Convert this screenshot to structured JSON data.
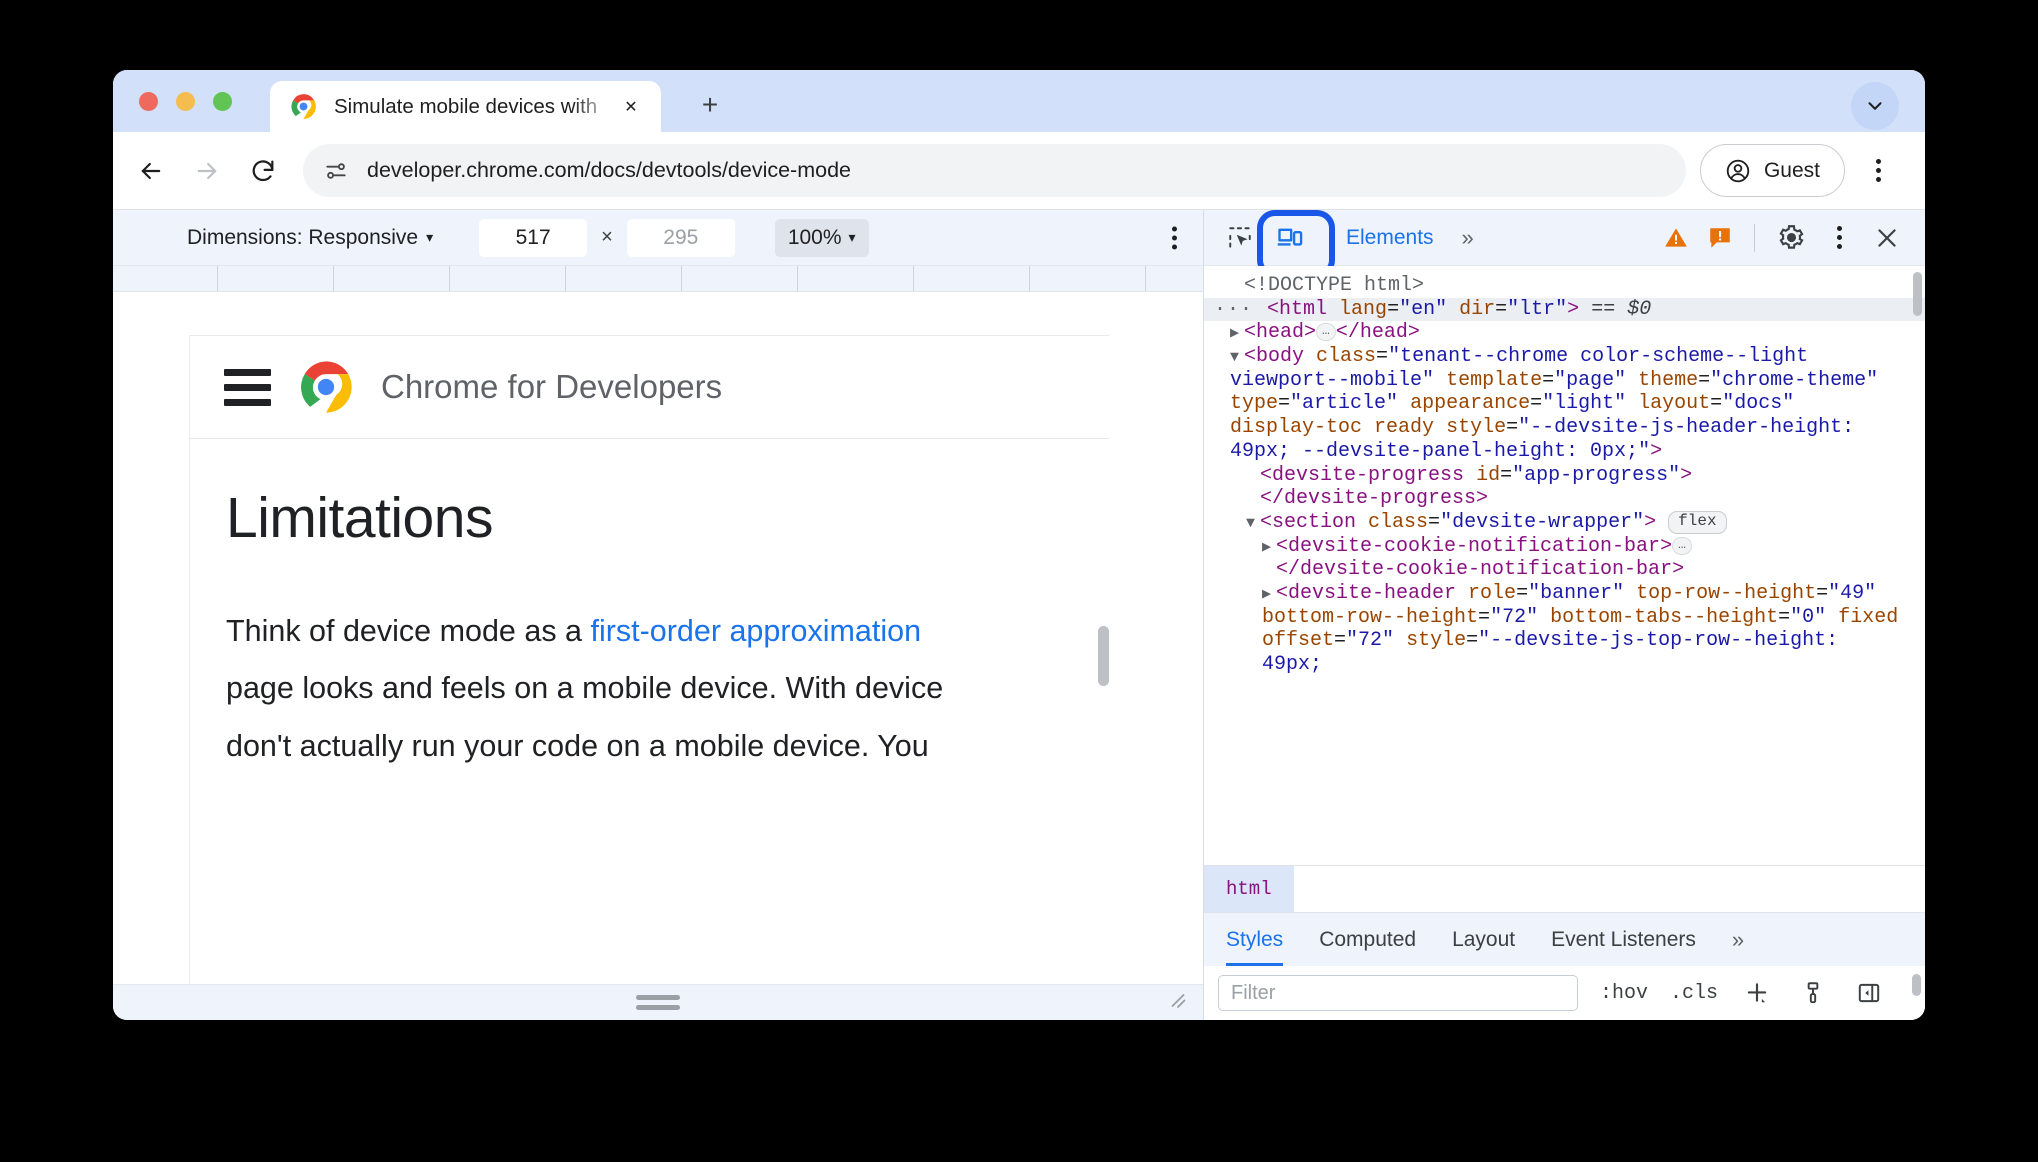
{
  "window": {
    "traffic_lights": [
      "close",
      "minimize",
      "maximize"
    ]
  },
  "tabstrip": {
    "tab_title": "Simulate mobile devices with",
    "close_label": "✕",
    "new_tab_label": "+",
    "collapse_label": "⌄"
  },
  "toolbar": {
    "back_label": "←",
    "forward_label": "→",
    "reload_label": "⟳",
    "url": "developer.chrome.com/docs/devtools/device-mode",
    "guest_label": "Guest"
  },
  "device_toolbar": {
    "dimensions_label": "Dimensions: Responsive",
    "dimensions_caret": "▾",
    "width_value": "517",
    "times": "×",
    "height_value": "295",
    "zoom_value": "100%",
    "zoom_caret": "▾"
  },
  "page": {
    "site_title": "Chrome for Developers",
    "heading": "Limitations",
    "paragraph_part1": "Think of device mode as a ",
    "paragraph_link": "first-order approximation",
    "paragraph_line2": "page looks and feels on a mobile device. With device",
    "paragraph_line3": "don't actually run your code on a mobile device. You"
  },
  "devtools": {
    "tabs": [
      {
        "label": "Elements",
        "active": true
      }
    ],
    "overflow_label": "»",
    "dom": [
      {
        "indent": 1,
        "prefix": "",
        "tri": "",
        "html": "<span class=\"txt\">&lt;!DOCTYPE html&gt;</span>",
        "selected": false
      },
      {
        "indent": 0,
        "prefix": "···",
        "tri": "",
        "html": "<span class=\"tag\">&lt;html</span> <span class=\"attr\">lang</span>=<span class=\"val\">\"en\"</span> <span class=\"attr\">dir</span>=<span class=\"val\">\"ltr\"</span><span class=\"tag\">&gt;</span> <span class=\"dollar\">== $0</span>",
        "selected": true
      },
      {
        "indent": 1,
        "prefix": "",
        "tri": "▶",
        "html": "<span class=\"tag\">&lt;head&gt;</span><span class=\"ellipsis-badge\">…</span><span class=\"tag\">&lt;/head&gt;</span>",
        "selected": false
      },
      {
        "indent": 1,
        "prefix": "",
        "tri": "▼",
        "html": "<span class=\"tag\">&lt;body</span> <span class=\"attr\">class</span>=<span class=\"val\">\"tenant--chrome color-scheme--light viewport--mobile\"</span> <span class=\"attr\">template</span>=<span class=\"val\">\"page\"</span> <span class=\"attr\">theme</span>=<span class=\"val\">\"chrome-theme\"</span> <span class=\"attr\">type</span>=<span class=\"val\">\"article\"</span> <span class=\"attr\">appearance</span>=<span class=\"val\">\"light\"</span> <span class=\"attr\">layout</span>=<span class=\"val\">\"docs\"</span> <span class=\"attr\">display-toc</span> <span class=\"attr\">ready</span> <span class=\"attr\">style</span>=<span class=\"val\">\"--devsite-js-header-height: 49px; --devsite-panel-height: 0px;\"</span><span class=\"tag\">&gt;</span>",
        "selected": false
      },
      {
        "indent": 2,
        "prefix": "",
        "tri": "",
        "html": "<span class=\"tag\">&lt;devsite-progress</span> <span class=\"attr\">id</span>=<span class=\"val\">\"app-progress\"</span><span class=\"tag\">&gt;</span>",
        "selected": false
      },
      {
        "indent": 2,
        "prefix": "",
        "tri": "",
        "html": "<span class=\"tag\">&lt;/devsite-progress&gt;</span>",
        "selected": false
      },
      {
        "indent": 2,
        "prefix": "",
        "tri": "▼",
        "html": "<span class=\"tag\">&lt;section</span> <span class=\"attr\">class</span>=<span class=\"val\">\"devsite-wrapper\"</span><span class=\"tag\">&gt;</span> <span class=\"flex-badge\">flex</span>",
        "selected": false
      },
      {
        "indent": 3,
        "prefix": "",
        "tri": "▶",
        "html": "<span class=\"tag\">&lt;devsite-cookie-notification-bar&gt;</span><span class=\"ellipsis-badge\">…</span>",
        "selected": false
      },
      {
        "indent": 3,
        "prefix": "",
        "tri": "",
        "html": "<span class=\"tag\">&lt;/devsite-cookie-notification-bar&gt;</span>",
        "selected": false
      },
      {
        "indent": 3,
        "prefix": "",
        "tri": "▶",
        "html": "<span class=\"tag\">&lt;devsite-header</span> <span class=\"attr\">role</span>=<span class=\"val\">\"banner\"</span> <span class=\"attr\">top-row--height</span>=<span class=\"val\">\"49\"</span> <span class=\"attr\">bottom-row--height</span>=<span class=\"val\">\"72\"</span> <span class=\"attr\">bottom-tabs--height</span>=<span class=\"val\">\"0\"</span> <span class=\"attr\">fixed</span> <span class=\"attr\">offset</span>=<span class=\"val\">\"72\"</span> <span class=\"attr\">style</span>=<span class=\"val\">\"--devsite-js-top-row--height: 49px;</span>",
        "selected": false
      }
    ],
    "breadcrumb": "html",
    "styles_tabs": [
      {
        "label": "Styles",
        "active": true
      },
      {
        "label": "Computed",
        "active": false
      },
      {
        "label": "Layout",
        "active": false
      },
      {
        "label": "Event Listeners",
        "active": false
      }
    ],
    "styles_overflow": "»",
    "filter_placeholder": "Filter",
    "hov_label": ":hov",
    "cls_label": ".cls"
  },
  "colors": {
    "accent_blue": "#1a73e8",
    "highlight_blue": "#1a56e8",
    "tabstrip_bg": "#d3e0fa",
    "toolbar_bg": "#eff3fb",
    "warning_orange": "#e8710a"
  }
}
